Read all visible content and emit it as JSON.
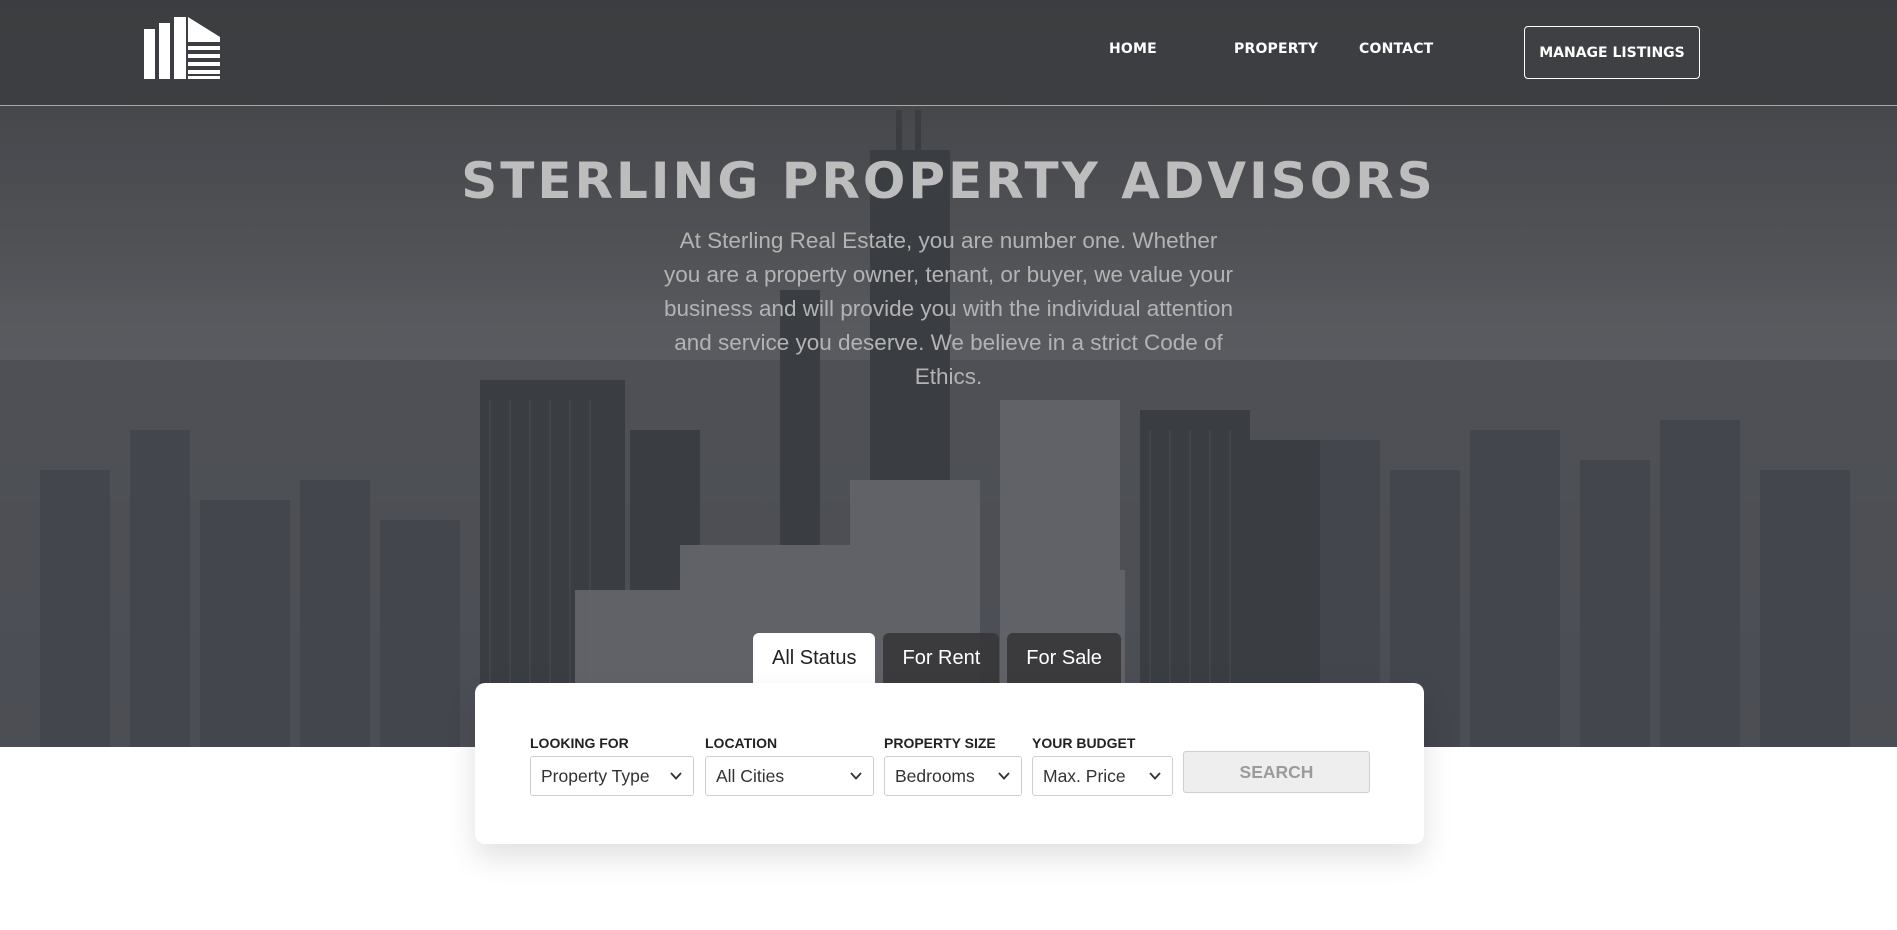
{
  "nav": {
    "links": [
      "HOME",
      "PROPERTY",
      "CONTACT"
    ],
    "manage_label": "MANAGE LISTINGS"
  },
  "hero": {
    "title": "STERLING PROPERTY ADVISORS",
    "text": "At Sterling Real Estate, you are number one. Whether you are a property owner, tenant, or buyer, we value your business and will provide you with the individual attention and service you deserve. We believe in a strict Code of Ethics."
  },
  "tabs": [
    {
      "label": "All Status",
      "active": true
    },
    {
      "label": "For Rent",
      "active": false
    },
    {
      "label": "For Sale",
      "active": false
    }
  ],
  "search": {
    "fields": [
      {
        "label": "LOOKING FOR",
        "value": "Property Type"
      },
      {
        "label": "LOCATION",
        "value": "All Cities"
      },
      {
        "label": "PROPERTY SIZE",
        "value": "Bedrooms"
      },
      {
        "label": "YOUR BUDGET",
        "value": "Max. Price"
      }
    ],
    "button_label": "SEARCH"
  },
  "colors": {
    "nav_bg": "#3c3d3f",
    "title": "#bdbdbd",
    "card": "#ffffff",
    "search_button_bg": "#eeeeee"
  },
  "icons": [
    "building-logo-icon",
    "chevron-down-icon"
  ]
}
